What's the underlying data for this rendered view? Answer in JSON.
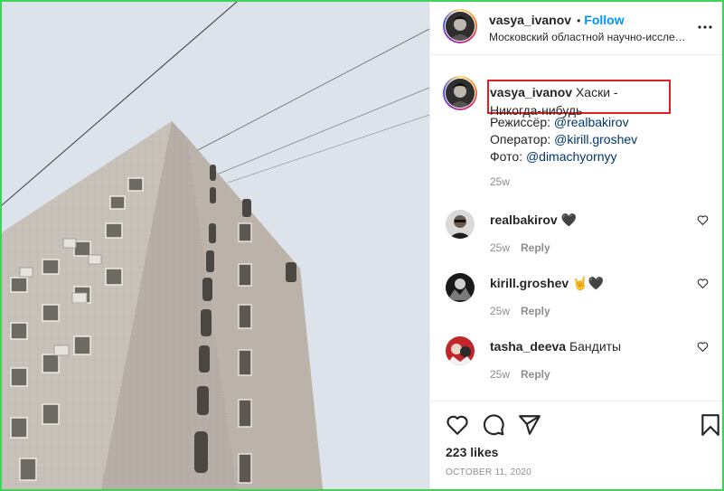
{
  "colors": {
    "follow": "#0095f6",
    "link": "#00376b",
    "highlight_box": "#e02020",
    "frame": "#3fd35a"
  },
  "header": {
    "username": "vasya_ivanov",
    "separator": "•",
    "follow_label": "Follow",
    "location": "Московский областной научно-исследоват...",
    "more_icon": "more-horizontal-icon"
  },
  "caption": {
    "username": "vasya_ivanov",
    "text": "Хаски - Никогда-нибудь",
    "credits": [
      {
        "label": "Режиссёр: ",
        "handle": "@realbakirov"
      },
      {
        "label": "Оператор: ",
        "handle": "@kirill.groshev"
      },
      {
        "label": "Фото: ",
        "handle": "@dimachyornyy"
      }
    ],
    "time": "25w"
  },
  "comments": [
    {
      "username": "realbakirov",
      "text": "🖤",
      "time": "25w",
      "reply": "Reply"
    },
    {
      "username": "kirill.groshev",
      "text": "🤘🖤",
      "time": "25w",
      "reply": "Reply"
    },
    {
      "username": "tasha_deeva",
      "text": "Бандиты",
      "time": "25w",
      "reply": "Reply"
    }
  ],
  "actions": {
    "icons": [
      "heart-icon",
      "comment-icon",
      "share-icon",
      "bookmark-icon"
    ],
    "likes": "223 likes",
    "date": "OCTOBER 11, 2020"
  }
}
